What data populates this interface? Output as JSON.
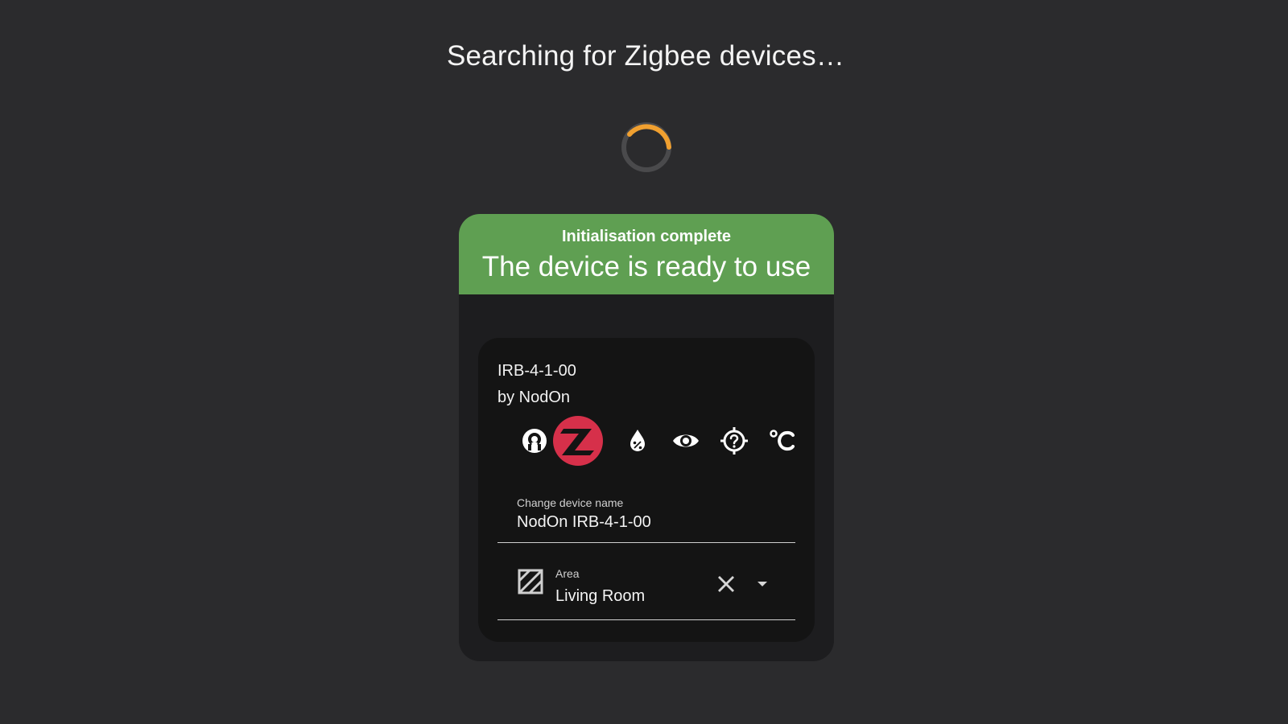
{
  "page": {
    "title": "Searching for Zigbee devices…"
  },
  "status": {
    "title": "Initialisation complete",
    "message": "The device is ready to use",
    "color": "#5f9f52"
  },
  "device": {
    "model": "IRB-4-1-00",
    "manufacturer": "by NodOn",
    "icons": [
      "integration-icon",
      "zigbee-logo-icon",
      "humidity-icon",
      "eye-icon",
      "unknown-location-icon",
      "celsius-icon"
    ],
    "name_field": {
      "label": "Change device name",
      "value": "NodOn IRB-4-1-00"
    },
    "area_field": {
      "label": "Area",
      "value": "Living Room"
    }
  },
  "colors": {
    "background": "#2b2b2d",
    "spinner_active": "#f0a030",
    "spinner_track": "#4a4a4c",
    "zigbee_red": "#d6304a",
    "card": "#1d1d1f",
    "inner_card": "#141414"
  }
}
